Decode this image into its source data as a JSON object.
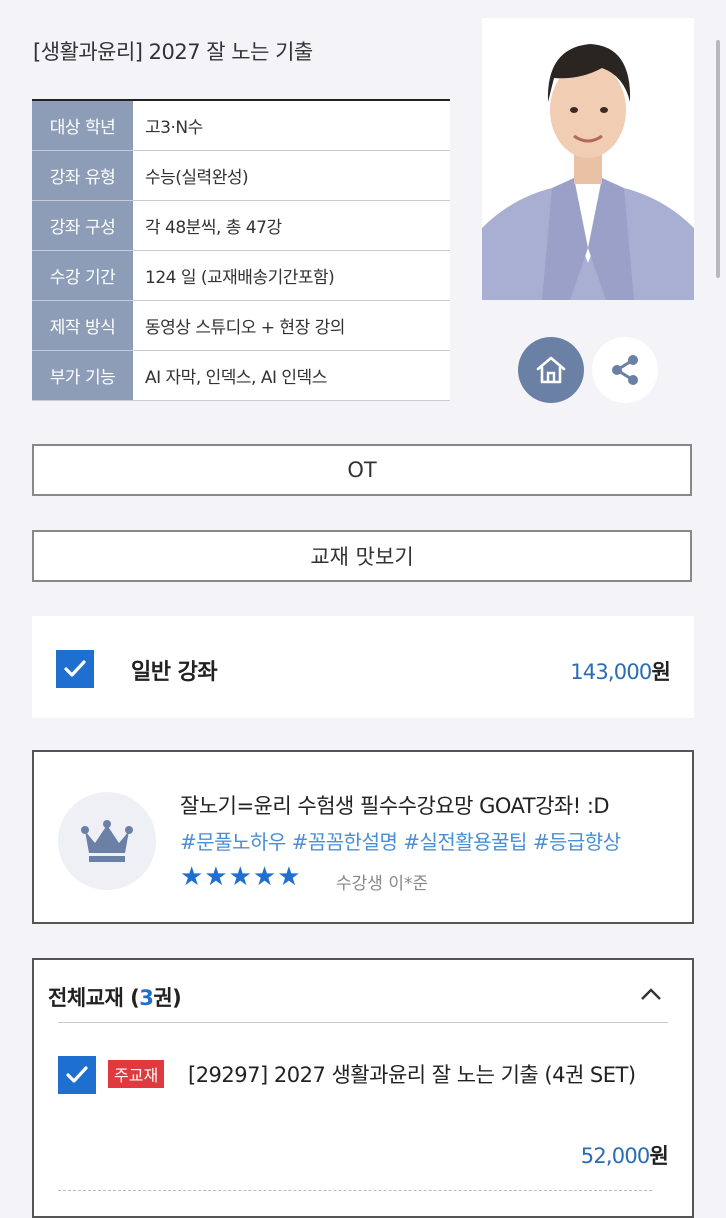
{
  "title": "[생활과윤리] 2027 잘 노는 기출",
  "info": [
    {
      "label": "대상 학년",
      "value": "고3·N수"
    },
    {
      "label": "강좌 유형",
      "value": "수능(실력완성)"
    },
    {
      "label": "강좌 구성",
      "value": "각 48분씩, 총 47강"
    },
    {
      "label": "수강 기간",
      "value": "124 일 (교재배송기간포함)"
    },
    {
      "label": "제작 방식",
      "value": "동영상 스튜디오 + 현장 강의"
    },
    {
      "label": "부가 기능",
      "value": "AI 자막, 인덱스, AI 인덱스"
    }
  ],
  "buttons": {
    "ot": "OT",
    "textbook_preview": "교재 맛보기"
  },
  "course": {
    "label": "일반 강좌",
    "price": "143,000",
    "currency": "원"
  },
  "review": {
    "title": "잘노기=윤리 수험생 필수수강요망 GOAT강좌! :D",
    "tags": "#문풀노하우 #꼼꼼한설명 #실전활용꿀팁 #등급향상",
    "stars": "★★★★★",
    "rating": 5,
    "reviewer": "수강생 이*준"
  },
  "books": {
    "header": "전체교재",
    "count_open": " (",
    "count": "3",
    "count_close": "권)",
    "badge": "주교재",
    "item_title": "[29297] 2027 생활과윤리 잘 노는 기출 (4권 SET)",
    "item_price": "52,000",
    "currency": "원"
  },
  "colors": {
    "accent": "#1f6fd1",
    "header_cell": "#8d9db8",
    "home_button": "#6b80a5",
    "badge": "#e0393e",
    "price": "#2a6db5"
  }
}
